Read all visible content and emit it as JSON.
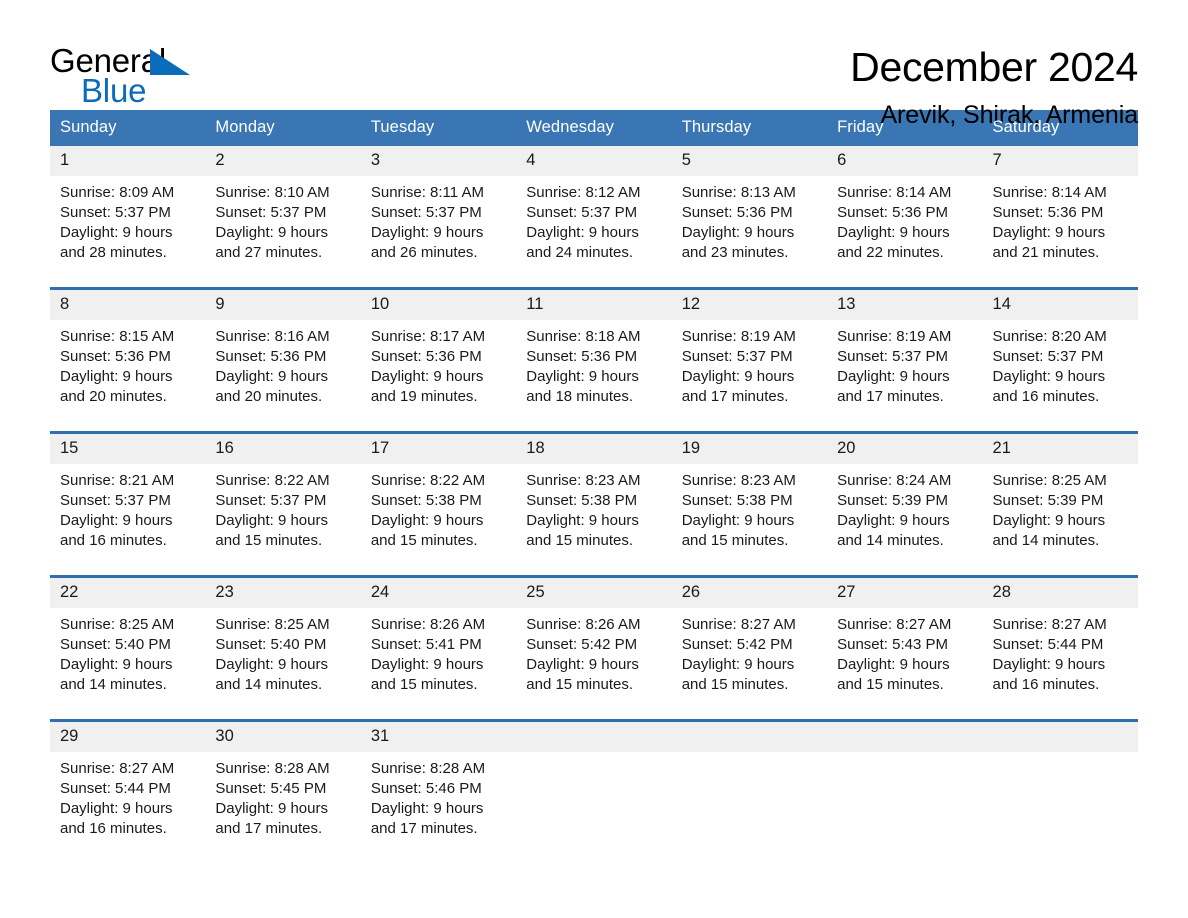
{
  "brand": {
    "word_general": "General",
    "word_blue": "Blue",
    "triangle_color": "#0a6cba"
  },
  "header": {
    "title": "December 2024",
    "subtitle": "Arevik, Shirak, Armenia"
  },
  "theme": {
    "header_blue": "#3a76b4",
    "row_divider_blue": "#2f6fae",
    "daynum_band": "#f0f0f0",
    "page_background": "#ffffff",
    "text": "#1a1a1a"
  },
  "weekday_headers": [
    "Sunday",
    "Monday",
    "Tuesday",
    "Wednesday",
    "Thursday",
    "Friday",
    "Saturday"
  ],
  "weeks": [
    {
      "days": [
        {
          "num": "1",
          "sunrise": "Sunrise: 8:09 AM",
          "sunset": "Sunset: 5:37 PM",
          "daylight_1": "Daylight: 9 hours",
          "daylight_2": "and 28 minutes."
        },
        {
          "num": "2",
          "sunrise": "Sunrise: 8:10 AM",
          "sunset": "Sunset: 5:37 PM",
          "daylight_1": "Daylight: 9 hours",
          "daylight_2": "and 27 minutes."
        },
        {
          "num": "3",
          "sunrise": "Sunrise: 8:11 AM",
          "sunset": "Sunset: 5:37 PM",
          "daylight_1": "Daylight: 9 hours",
          "daylight_2": "and 26 minutes."
        },
        {
          "num": "4",
          "sunrise": "Sunrise: 8:12 AM",
          "sunset": "Sunset: 5:37 PM",
          "daylight_1": "Daylight: 9 hours",
          "daylight_2": "and 24 minutes."
        },
        {
          "num": "5",
          "sunrise": "Sunrise: 8:13 AM",
          "sunset": "Sunset: 5:36 PM",
          "daylight_1": "Daylight: 9 hours",
          "daylight_2": "and 23 minutes."
        },
        {
          "num": "6",
          "sunrise": "Sunrise: 8:14 AM",
          "sunset": "Sunset: 5:36 PM",
          "daylight_1": "Daylight: 9 hours",
          "daylight_2": "and 22 minutes."
        },
        {
          "num": "7",
          "sunrise": "Sunrise: 8:14 AM",
          "sunset": "Sunset: 5:36 PM",
          "daylight_1": "Daylight: 9 hours",
          "daylight_2": "and 21 minutes."
        }
      ]
    },
    {
      "days": [
        {
          "num": "8",
          "sunrise": "Sunrise: 8:15 AM",
          "sunset": "Sunset: 5:36 PM",
          "daylight_1": "Daylight: 9 hours",
          "daylight_2": "and 20 minutes."
        },
        {
          "num": "9",
          "sunrise": "Sunrise: 8:16 AM",
          "sunset": "Sunset: 5:36 PM",
          "daylight_1": "Daylight: 9 hours",
          "daylight_2": "and 20 minutes."
        },
        {
          "num": "10",
          "sunrise": "Sunrise: 8:17 AM",
          "sunset": "Sunset: 5:36 PM",
          "daylight_1": "Daylight: 9 hours",
          "daylight_2": "and 19 minutes."
        },
        {
          "num": "11",
          "sunrise": "Sunrise: 8:18 AM",
          "sunset": "Sunset: 5:36 PM",
          "daylight_1": "Daylight: 9 hours",
          "daylight_2": "and 18 minutes."
        },
        {
          "num": "12",
          "sunrise": "Sunrise: 8:19 AM",
          "sunset": "Sunset: 5:37 PM",
          "daylight_1": "Daylight: 9 hours",
          "daylight_2": "and 17 minutes."
        },
        {
          "num": "13",
          "sunrise": "Sunrise: 8:19 AM",
          "sunset": "Sunset: 5:37 PM",
          "daylight_1": "Daylight: 9 hours",
          "daylight_2": "and 17 minutes."
        },
        {
          "num": "14",
          "sunrise": "Sunrise: 8:20 AM",
          "sunset": "Sunset: 5:37 PM",
          "daylight_1": "Daylight: 9 hours",
          "daylight_2": "and 16 minutes."
        }
      ]
    },
    {
      "days": [
        {
          "num": "15",
          "sunrise": "Sunrise: 8:21 AM",
          "sunset": "Sunset: 5:37 PM",
          "daylight_1": "Daylight: 9 hours",
          "daylight_2": "and 16 minutes."
        },
        {
          "num": "16",
          "sunrise": "Sunrise: 8:22 AM",
          "sunset": "Sunset: 5:37 PM",
          "daylight_1": "Daylight: 9 hours",
          "daylight_2": "and 15 minutes."
        },
        {
          "num": "17",
          "sunrise": "Sunrise: 8:22 AM",
          "sunset": "Sunset: 5:38 PM",
          "daylight_1": "Daylight: 9 hours",
          "daylight_2": "and 15 minutes."
        },
        {
          "num": "18",
          "sunrise": "Sunrise: 8:23 AM",
          "sunset": "Sunset: 5:38 PM",
          "daylight_1": "Daylight: 9 hours",
          "daylight_2": "and 15 minutes."
        },
        {
          "num": "19",
          "sunrise": "Sunrise: 8:23 AM",
          "sunset": "Sunset: 5:38 PM",
          "daylight_1": "Daylight: 9 hours",
          "daylight_2": "and 15 minutes."
        },
        {
          "num": "20",
          "sunrise": "Sunrise: 8:24 AM",
          "sunset": "Sunset: 5:39 PM",
          "daylight_1": "Daylight: 9 hours",
          "daylight_2": "and 14 minutes."
        },
        {
          "num": "21",
          "sunrise": "Sunrise: 8:25 AM",
          "sunset": "Sunset: 5:39 PM",
          "daylight_1": "Daylight: 9 hours",
          "daylight_2": "and 14 minutes."
        }
      ]
    },
    {
      "days": [
        {
          "num": "22",
          "sunrise": "Sunrise: 8:25 AM",
          "sunset": "Sunset: 5:40 PM",
          "daylight_1": "Daylight: 9 hours",
          "daylight_2": "and 14 minutes."
        },
        {
          "num": "23",
          "sunrise": "Sunrise: 8:25 AM",
          "sunset": "Sunset: 5:40 PM",
          "daylight_1": "Daylight: 9 hours",
          "daylight_2": "and 14 minutes."
        },
        {
          "num": "24",
          "sunrise": "Sunrise: 8:26 AM",
          "sunset": "Sunset: 5:41 PM",
          "daylight_1": "Daylight: 9 hours",
          "daylight_2": "and 15 minutes."
        },
        {
          "num": "25",
          "sunrise": "Sunrise: 8:26 AM",
          "sunset": "Sunset: 5:42 PM",
          "daylight_1": "Daylight: 9 hours",
          "daylight_2": "and 15 minutes."
        },
        {
          "num": "26",
          "sunrise": "Sunrise: 8:27 AM",
          "sunset": "Sunset: 5:42 PM",
          "daylight_1": "Daylight: 9 hours",
          "daylight_2": "and 15 minutes."
        },
        {
          "num": "27",
          "sunrise": "Sunrise: 8:27 AM",
          "sunset": "Sunset: 5:43 PM",
          "daylight_1": "Daylight: 9 hours",
          "daylight_2": "and 15 minutes."
        },
        {
          "num": "28",
          "sunrise": "Sunrise: 8:27 AM",
          "sunset": "Sunset: 5:44 PM",
          "daylight_1": "Daylight: 9 hours",
          "daylight_2": "and 16 minutes."
        }
      ]
    },
    {
      "days": [
        {
          "num": "29",
          "sunrise": "Sunrise: 8:27 AM",
          "sunset": "Sunset: 5:44 PM",
          "daylight_1": "Daylight: 9 hours",
          "daylight_2": "and 16 minutes."
        },
        {
          "num": "30",
          "sunrise": "Sunrise: 8:28 AM",
          "sunset": "Sunset: 5:45 PM",
          "daylight_1": "Daylight: 9 hours",
          "daylight_2": "and 17 minutes."
        },
        {
          "num": "31",
          "sunrise": "Sunrise: 8:28 AM",
          "sunset": "Sunset: 5:46 PM",
          "daylight_1": "Daylight: 9 hours",
          "daylight_2": "and 17 minutes."
        },
        {
          "num": "",
          "sunrise": "",
          "sunset": "",
          "daylight_1": "",
          "daylight_2": ""
        },
        {
          "num": "",
          "sunrise": "",
          "sunset": "",
          "daylight_1": "",
          "daylight_2": ""
        },
        {
          "num": "",
          "sunrise": "",
          "sunset": "",
          "daylight_1": "",
          "daylight_2": ""
        },
        {
          "num": "",
          "sunrise": "",
          "sunset": "",
          "daylight_1": "",
          "daylight_2": ""
        }
      ]
    }
  ]
}
